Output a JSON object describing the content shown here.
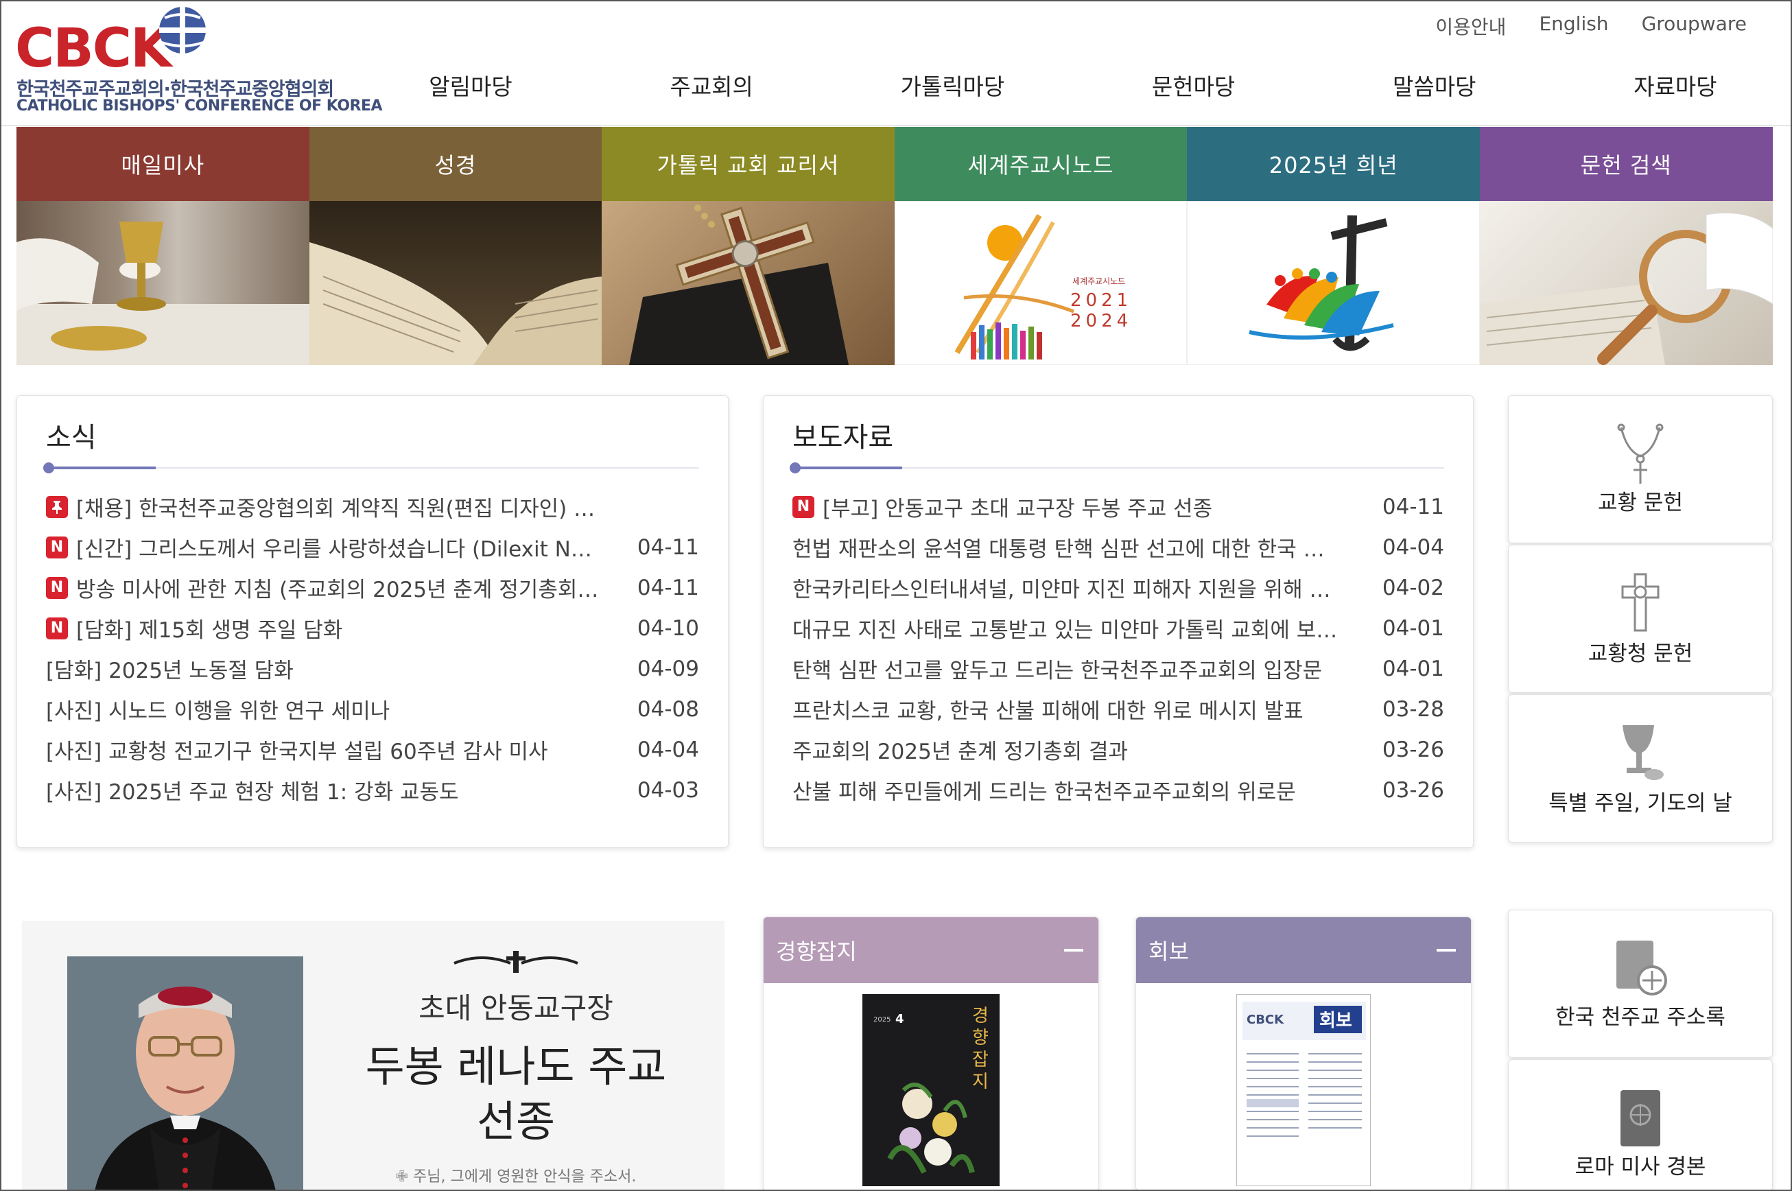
{
  "header": {
    "logo_word": "CBCK",
    "logo_korean": "한국천주교주교회의·한국천주교중앙협의회",
    "logo_english": "CATHOLIC BISHOPS' CONFERENCE OF KOREA",
    "util_links": [
      "이용안내",
      "English",
      "Groupware"
    ],
    "nav": [
      "알림마당",
      "주교회의",
      "가톨릭마당",
      "문헌마당",
      "말씀마당",
      "자료마당"
    ]
  },
  "banner": [
    {
      "label": "매일미사",
      "color": "#8b3a32"
    },
    {
      "label": "성경",
      "color": "#7a6138"
    },
    {
      "label": "가톨릭 교회 교리서",
      "color": "#8c8a24"
    },
    {
      "label": "세계주교시노드",
      "color": "#3e8c5e"
    },
    {
      "label": "2025년 희년",
      "color": "#2c6e80"
    },
    {
      "label": "문헌 검색",
      "color": "#7b4f97"
    }
  ],
  "synod_logo_text": {
    "line1": "세계주교시노드",
    "line2": "2021",
    "line3": "2024"
  },
  "news": {
    "title": "소식",
    "items": [
      {
        "badge": "pin",
        "title": "[채용] 한국천주교중앙협의회 계약직 직원(편집 디자인) …",
        "date": ""
      },
      {
        "badge": "N",
        "title": "[신간] 그리스도께서 우리를 사랑하셨습니다 (Dilexit N…",
        "date": "04-11"
      },
      {
        "badge": "N",
        "title": "방송 미사에 관한 지침 (주교회의 2025년 춘계 정기총회…",
        "date": "04-11"
      },
      {
        "badge": "N",
        "title": "[담화] 제15회 생명 주일 담화",
        "date": "04-10"
      },
      {
        "badge": "",
        "title": "[담화] 2025년 노동절 담화",
        "date": "04-09"
      },
      {
        "badge": "",
        "title": "[사진] 시노드 이행을 위한 연구 세미나",
        "date": "04-08"
      },
      {
        "badge": "",
        "title": "[사진] 교황청 전교기구 한국지부 설립 60주년 감사 미사",
        "date": "04-04"
      },
      {
        "badge": "",
        "title": "[사진] 2025년 주교 현장 체험 1: 강화 교동도",
        "date": "04-03"
      }
    ]
  },
  "press": {
    "title": "보도자료",
    "items": [
      {
        "badge": "N",
        "title": "[부고] 안동교구 초대 교구장 두봉 주교 선종",
        "date": "04-11"
      },
      {
        "badge": "",
        "title": "헌법 재판소의 윤석열 대통령 탄핵 심판 선고에 대한 한국 …",
        "date": "04-04"
      },
      {
        "badge": "",
        "title": "한국카리타스인터내셔널, 미얀마 지진 피해자 지원을 위해 …",
        "date": "04-02"
      },
      {
        "badge": "",
        "title": "대규모 지진 사태로 고통받고 있는 미얀마 가톨릭 교회에 보…",
        "date": "04-01"
      },
      {
        "badge": "",
        "title": "탄핵 심판 선고를 앞두고 드리는 한국천주교주교회의 입장문",
        "date": "04-01"
      },
      {
        "badge": "",
        "title": "프란치스코 교황, 한국 산불 피해에 대한 위로 메시지 발표",
        "date": "03-28"
      },
      {
        "badge": "",
        "title": "주교회의 2025년 춘계 정기총회 결과",
        "date": "03-26"
      },
      {
        "badge": "",
        "title": "산불 피해 주민들에게 드리는 한국천주교주교회의 위로문",
        "date": "03-26"
      }
    ]
  },
  "quick_links": [
    {
      "label": "교황 문헌",
      "icon": "rosary-icon"
    },
    {
      "label": "교황청 문헌",
      "icon": "cross-ornate-icon"
    },
    {
      "label": "특별 주일, 기도의 날",
      "icon": "chalice-icon"
    },
    {
      "label": "한국 천주교 주소록",
      "icon": "address-book-icon"
    },
    {
      "label": "로마 미사 경본",
      "icon": "missal-icon"
    }
  ],
  "feature": {
    "subtitle": "초대 안동교구장",
    "main_line1": "두봉 레나도 주교",
    "main_line2": "선종",
    "prayer": "주님, 그에게 영원한 안식을 주소서."
  },
  "magazines": [
    {
      "title": "경향잡지",
      "head_color": "#b59bb6",
      "cover_text": "경향잡지",
      "cover_number": "4",
      "cover_year": "2025"
    },
    {
      "title": "회보",
      "head_color": "#8d85ab",
      "cover_logo": "CBCK",
      "cover_text": "회보"
    }
  ],
  "colors": {
    "accent": "#7377b8",
    "new_badge": "#d9232e",
    "logo_red": "#c8242a",
    "logo_blue": "#3f4f7a"
  }
}
